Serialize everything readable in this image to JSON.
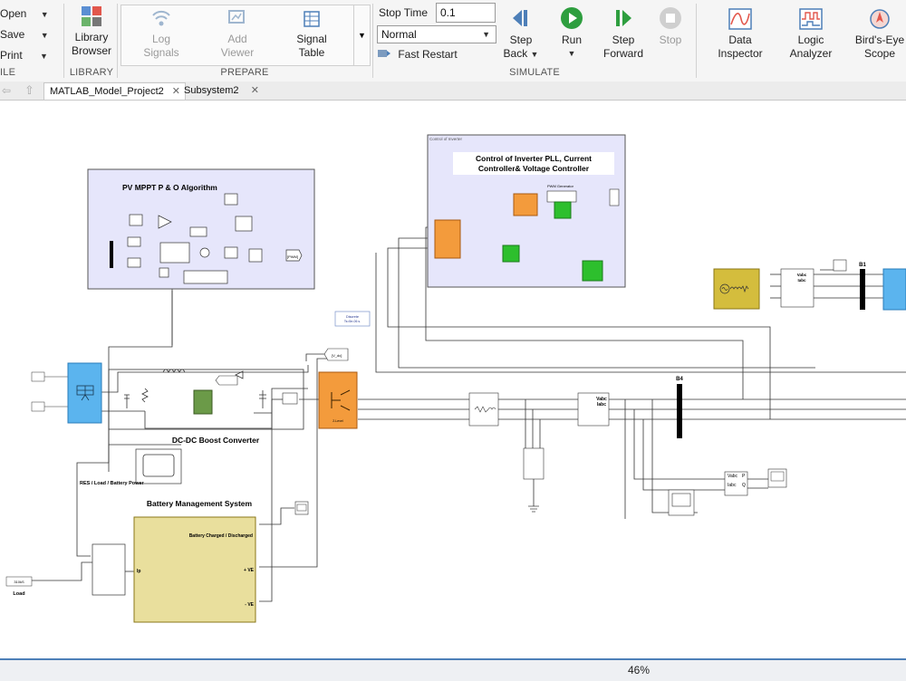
{
  "toolstrip": {
    "file": {
      "open": "Open",
      "save": "Save",
      "print": "Print",
      "section": "ILE"
    },
    "library": {
      "label_line1": "Library",
      "label_line2": "Browser",
      "section": "LIBRARY"
    },
    "prepare": {
      "log_line1": "Log",
      "log_line2": "Signals",
      "add_line1": "Add",
      "add_line2": "Viewer",
      "table_line1": "Signal",
      "table_line2": "Table",
      "section": "PREPARE"
    },
    "simulate": {
      "stop_time_label": "Stop Time",
      "stop_time_value": "0.1",
      "mode_value": "Normal",
      "fast_restart": "Fast Restart",
      "step_back_1": "Step",
      "step_back_2": "Back",
      "run": "Run",
      "step_fwd_1": "Step",
      "step_fwd_2": "Forward",
      "stop": "Stop",
      "section": "SIMULATE"
    },
    "review": {
      "data_1": "Data",
      "data_2": "Inspector",
      "logic_1": "Logic",
      "logic_2": "Analyzer",
      "birds_1": "Bird's-Eye",
      "birds_2": "Scope"
    }
  },
  "tabs": [
    {
      "label": "MATLAB_Model_Project2"
    },
    {
      "label": "Subsystem2"
    }
  ],
  "model": {
    "mppt_title": "PV MPPT P & O Algorithm",
    "inverter_ctrl_small": "Control of Inverter",
    "inverter_ctrl_title_1": "Control of Inverter PLL, Current",
    "inverter_ctrl_title_2": "Controller& Voltage Controller",
    "dc_dc_title": "DC-DC Boost Converter",
    "bms_title": "Battery Management System",
    "bms_port_charged": "Battery Charged / Discharged",
    "bms_port_pve": "+ VE",
    "bms_port_nve": "- VE",
    "bms_port_ip": "Ip",
    "res_label": "RES / Load / Battery Power",
    "load_label": "Load",
    "load_value": "310kS",
    "v_dc_tag": "[V_dc]",
    "pwm_tag": "[PWM]",
    "b4": "B4",
    "b1": "B1",
    "two_level": "2-Level",
    "discrete": "Discrete",
    "discrete_ts": "Ts=5e-06 s.",
    "pwm_gen": "PWM Generator",
    "vabc": "Vabc",
    "iabc": "Iabc",
    "p_port": "P",
    "q_port": "Q"
  },
  "status": {
    "zoom": "46%"
  },
  "colors": {
    "accent": "#4d7fb8",
    "subsystem_fill": "#e6e6fb",
    "bms_fill": "#e9df9d",
    "inverter_fill": "#f39b3c",
    "pv_fill": "#5bb4ee",
    "scope_green": "#2dbf2d"
  }
}
